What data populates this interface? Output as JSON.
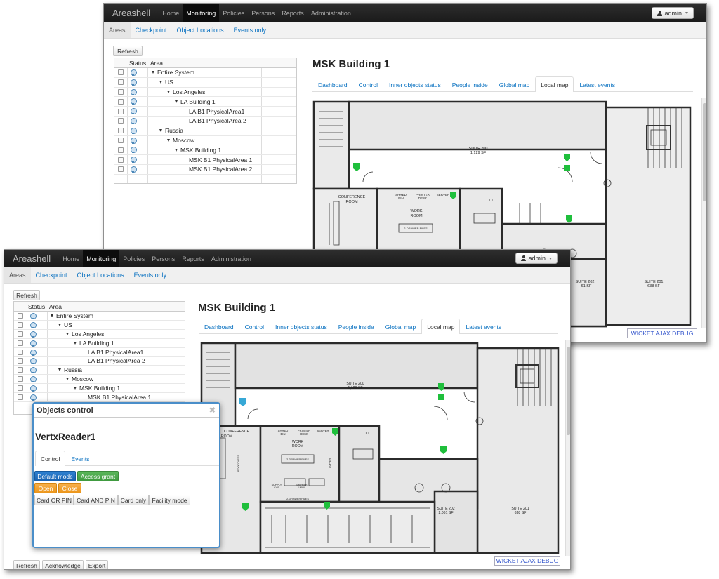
{
  "app": {
    "brand": "Areashell",
    "nav": [
      "Home",
      "Monitoring",
      "Policies",
      "Persons",
      "Reports",
      "Administration"
    ],
    "active_nav": "Monitoring",
    "user": "admin"
  },
  "subnav": [
    "Areas",
    "Checkpoint",
    "Object Locations",
    "Events only"
  ],
  "active_subnav": "Areas",
  "refresh_label": "Refresh",
  "table": {
    "headers": [
      "Status",
      "Area"
    ],
    "rows": [
      {
        "label": "Entire System",
        "expandable": true
      },
      {
        "label": "US",
        "expandable": true
      },
      {
        "label": "Los Angeles",
        "expandable": true
      },
      {
        "label": "LA Building 1",
        "expandable": true
      },
      {
        "label": "LA B1 PhysicalArea1",
        "expandable": false
      },
      {
        "label": "LA B1 PhysicalArea 2",
        "expandable": false
      },
      {
        "label": "Russia",
        "expandable": true
      },
      {
        "label": "Moscow",
        "expandable": true
      },
      {
        "label": "MSK Building 1",
        "expandable": true
      },
      {
        "label": "MSK B1 PhysicalArea 1",
        "expandable": false
      },
      {
        "label": "MSK B1 PhysicalArea 2",
        "expandable": false
      }
    ]
  },
  "building": {
    "title": "MSK Building 1",
    "tabs": [
      "Dashboard",
      "Control",
      "Inner objects status",
      "People inside",
      "Global map",
      "Local map",
      "Latest events"
    ],
    "active_tab": "Local map"
  },
  "map_labels": {
    "suite200": "SUITE 200",
    "suite200_sf": "1,129 SF",
    "conference": "CONFERENCE",
    "conference2": "ROOM",
    "shred": "SHRED",
    "shred2": "BIN",
    "printer": "PRINTER",
    "printer2": "DESK",
    "server": "SERVER",
    "work": "WORK",
    "work2": "ROOM",
    "it": "I.T.",
    "drawer": "2-DRAWER FILES",
    "supply": "SUPPLY",
    "supply2": "CAB",
    "shipping": "SHIPPING",
    "shipping2": "/ MAIL",
    "copier": "COPIER",
    "bookcases": "BOOKCASES",
    "suite202": "SUITE 202",
    "suite202_sf": "2,061 SF",
    "suite201": "SUITE 201",
    "suite201_sf": "638 SF",
    "w1_suite202_sf": "61 SF"
  },
  "debug_label": "WICKET AJAX DEBUG",
  "modal": {
    "header": "Objects control",
    "close": "✖",
    "title": "VertxReader1",
    "tabs": [
      "Control",
      "Events"
    ],
    "buttons": {
      "default_mode": "Default mode",
      "access_grant": "Access grant",
      "open": "Open",
      "close": "Close",
      "card_or_pin": "Card OR PIN",
      "card_and_pin": "Card AND PIN",
      "card_only": "Card only",
      "facility_mode": "Facility mode"
    }
  },
  "footer_buttons": [
    "Refresh",
    "Acknowledge",
    "Export"
  ],
  "colors": {
    "navbar": "#1f1f1f",
    "link": "#0770c0",
    "primary": "#1a6fc4",
    "success": "#49a84a",
    "warning": "#f2a234",
    "marker": "#1fbf3c",
    "marker_selected": "#37a8d6"
  }
}
